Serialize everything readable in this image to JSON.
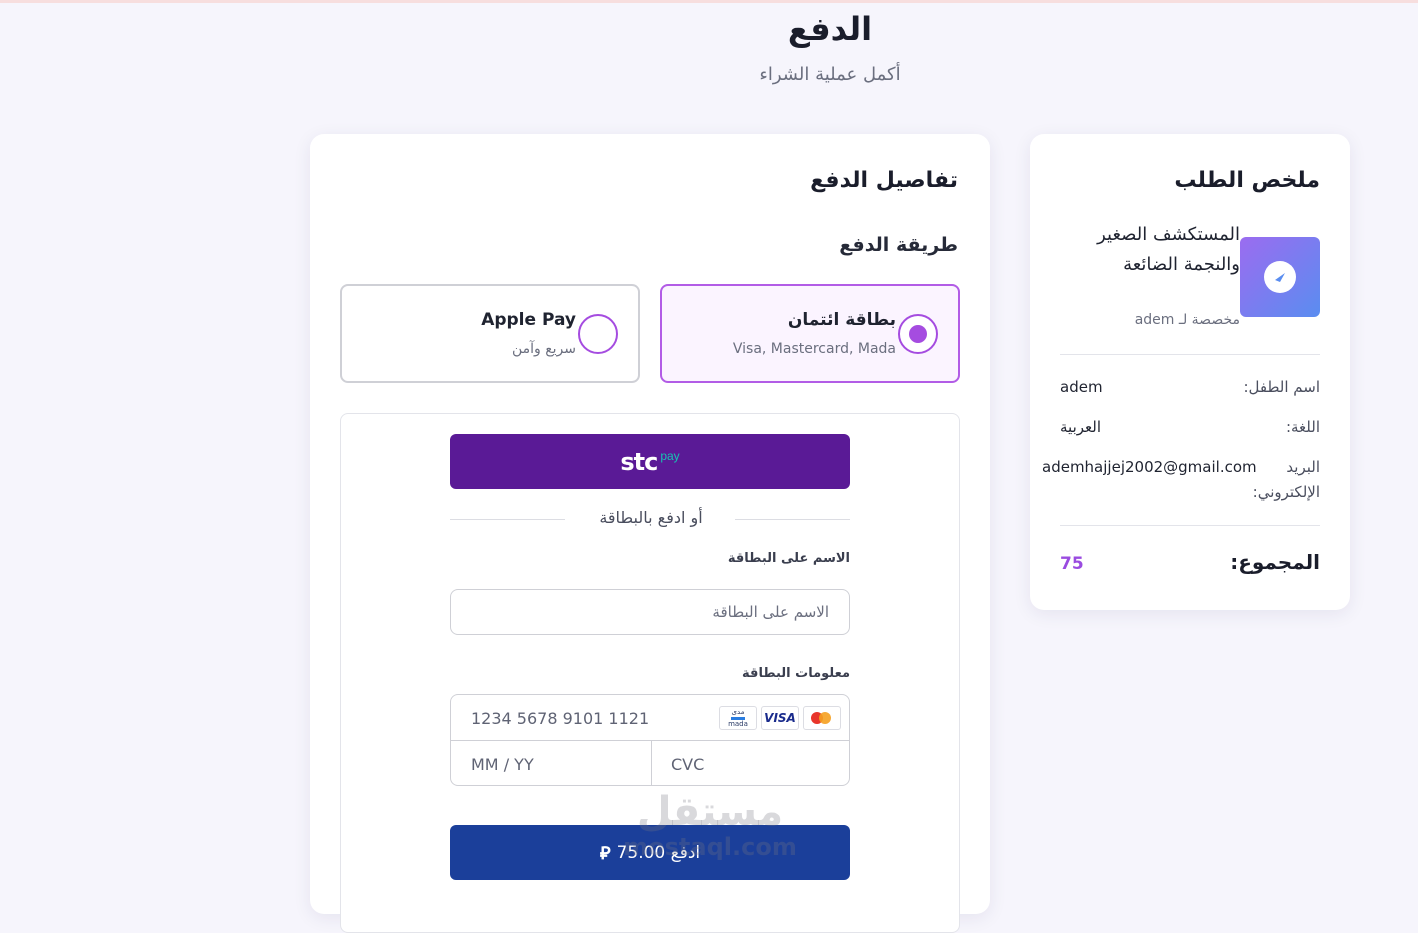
{
  "header": {
    "title": "الدفع",
    "subtitle": "أكمل عملية الشراء"
  },
  "payment": {
    "title": "تفاصيل الدفع",
    "method_heading": "طريقة الدفع",
    "methods": [
      {
        "name": "بطاقة ائتمان",
        "desc": "Visa, Mastercard, Mada",
        "selected": true
      },
      {
        "name": "Apple Pay",
        "desc": "سريع وآمن",
        "selected": false
      }
    ],
    "stc_button": {
      "logo": "stc",
      "suffix": "pay"
    },
    "divider": "أو ادفع بالبطاقة",
    "name_label": "الاسم على البطاقة",
    "name_placeholder": "الاسم على البطاقة",
    "info_label": "معلومات البطاقة",
    "card_number_placeholder": "1234 5678 9101 1121",
    "expiry_placeholder": "MM / YY",
    "cvc_placeholder": "CVC",
    "brand_icons": [
      "mada-icon",
      "visa-icon",
      "mastercard-icon"
    ],
    "mada_text": "مدى",
    "mada_sub": "mada",
    "visa_text": "VISA",
    "pay_button": "ادفع 75.00",
    "currency_icon": "riyal-icon"
  },
  "watermark": {
    "arabic": "مستقل",
    "latin": "mostaql.com"
  },
  "summary": {
    "title": "ملخص الطلب",
    "product_title": "المستكشف الصغير والنجمة الضائعة",
    "product_sub": "مخصصة لـ adem",
    "product_icon": "compass-icon",
    "rows": [
      {
        "label": "اسم الطفل:",
        "value": "adem"
      },
      {
        "label": "اللغة:",
        "value": "العربية"
      },
      {
        "label": "البريد الإلكتروني:",
        "value": "ademhajjej2002@gmail.com"
      }
    ],
    "total_label": "المجموع:",
    "total_value": "75"
  },
  "colors": {
    "accent": "#a54ce0",
    "stc": "#5a1a96",
    "pay_button": "#1b3f9a",
    "total": "#9a4be0"
  }
}
